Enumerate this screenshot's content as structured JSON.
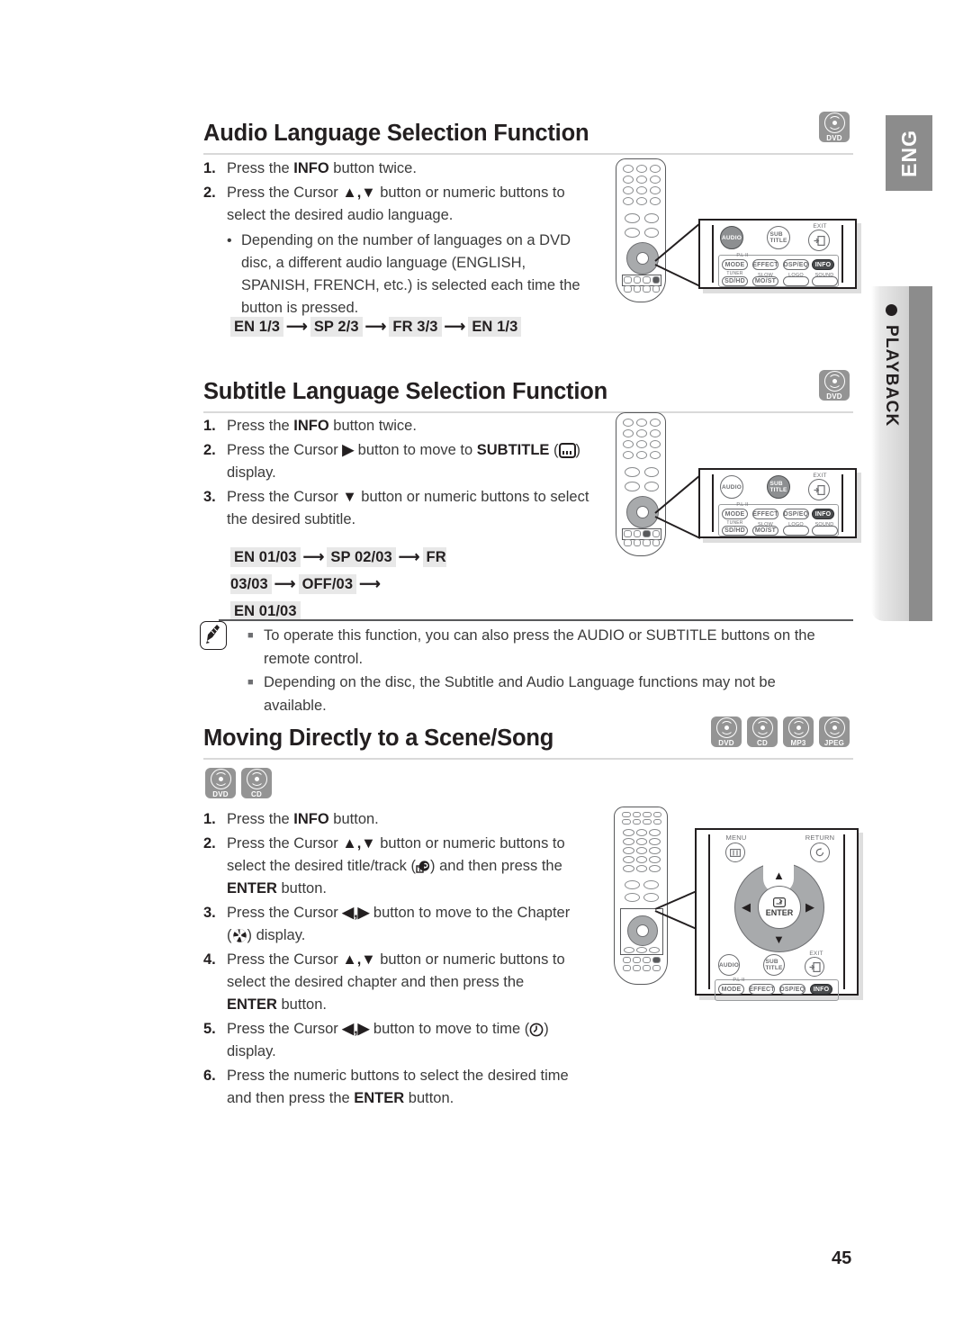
{
  "page": {
    "number": "45",
    "language_tab": "ENG",
    "section_tab": "PLAYBACK"
  },
  "sections": [
    {
      "id": "audio-language",
      "heading": "Audio Language Selection Function",
      "badges": [
        "DVD"
      ],
      "steps": [
        {
          "num": "1.",
          "parts": [
            {
              "t": "Press the "
            },
            {
              "t": "INFO",
              "b": true
            },
            {
              "t": " button twice."
            }
          ]
        },
        {
          "num": "2.",
          "parts": [
            {
              "t": "Press the Cursor "
            },
            {
              "t": "▲,▼",
              "b": true
            },
            {
              "t": " button or numeric buttons to select the desired audio language."
            }
          ]
        }
      ],
      "sub_bullet": "Depending on the number of languages on a DVD disc, a different audio language (ENGLISH, SPANISH, FRENCH, etc.) is selected each time the button is pressed.",
      "sequence": [
        "EN 1/3",
        "SP 2/3",
        "FR 3/3",
        "EN 1/3"
      ]
    },
    {
      "id": "subtitle-language",
      "heading": "Subtitle Language Selection Function",
      "badges": [
        "DVD"
      ],
      "steps": [
        {
          "num": "1.",
          "parts": [
            {
              "t": "Press the "
            },
            {
              "t": "INFO",
              "b": true
            },
            {
              "t": " button twice."
            }
          ]
        },
        {
          "num": "2.",
          "parts": [
            {
              "t": "Press the Cursor "
            },
            {
              "t": "▶",
              "b": true
            },
            {
              "t": " button to move to "
            },
            {
              "t": "SUBTITLE",
              "b": true
            },
            {
              "t": " (",
              "icon": "subtitle-icon"
            },
            {
              "t": ") display."
            }
          ]
        },
        {
          "num": "3.",
          "parts": [
            {
              "t": "Press the Cursor "
            },
            {
              "t": "▼",
              "b": true
            },
            {
              "t": " button or numeric buttons to select the desired subtitle."
            }
          ]
        }
      ],
      "sequence": [
        "EN 01/03",
        "SP 02/03",
        "FR 03/03",
        "OFF/03",
        "EN 01/03"
      ]
    },
    {
      "id": "moving-directly",
      "heading": "Moving Directly to a Scene/Song",
      "badges": [
        "DVD",
        "CD",
        "MP3",
        "JPEG"
      ],
      "inline_badges": [
        "DVD",
        "CD"
      ],
      "steps": [
        {
          "num": "1.",
          "parts": [
            {
              "t": "Press the "
            },
            {
              "t": "INFO",
              "b": true
            },
            {
              "t": " button."
            }
          ]
        },
        {
          "num": "2.",
          "parts": [
            {
              "t": "Press the Cursor "
            },
            {
              "t": "▲,▼",
              "b": true
            },
            {
              "t": " button or numeric buttons to select the desired title/track ("
            },
            {
              "icon": "title-track-icon"
            },
            {
              "t": ")  and then press the "
            },
            {
              "t": "ENTER",
              "b": true
            },
            {
              "t": " button."
            }
          ]
        },
        {
          "num": "3.",
          "parts": [
            {
              "t": "Press the Cursor "
            },
            {
              "t": "◀,▶",
              "b": true
            },
            {
              "t": " button to move to the Chapter ("
            },
            {
              "icon": "chapter-icon"
            },
            {
              "t": ") display."
            }
          ]
        },
        {
          "num": "4.",
          "parts": [
            {
              "t": "Press the Cursor "
            },
            {
              "t": "▲,▼",
              "b": true
            },
            {
              "t": " button or numeric buttons to select the desired chapter and then press the "
            },
            {
              "t": "ENTER",
              "b": true
            },
            {
              "t": " button."
            }
          ]
        },
        {
          "num": "5.",
          "parts": [
            {
              "t": "Press the Cursor "
            },
            {
              "t": "◀,▶",
              "b": true
            },
            {
              "t": " button to move to time ("
            },
            {
              "icon": "time-icon"
            },
            {
              "t": ") display."
            }
          ]
        },
        {
          "num": "6.",
          "parts": [
            {
              "t": "Press the numeric buttons to select the desired time and then press the "
            },
            {
              "t": "ENTER",
              "b": true
            },
            {
              "t": " button."
            }
          ]
        }
      ]
    }
  ],
  "note": {
    "icon": "note-pencil-icon",
    "items": [
      "To operate this function, you can also press the AUDIO or SUBTITLE buttons on the remote control.",
      "Depending on the disc, the Subtitle and Audio Language functions may not be available."
    ]
  },
  "callouts": {
    "audio": {
      "top_buttons": [
        {
          "label": "AUDIO",
          "highlighted": true
        },
        {
          "label": "SUB\nTITLE",
          "highlighted": false
        },
        {
          "label": "EXIT",
          "highlighted": false,
          "is_exit": true
        }
      ],
      "group_label": "P.L II",
      "row1": [
        {
          "label": "MODE",
          "highlighted": false
        },
        {
          "label": "EFFECT",
          "highlighted": false
        },
        {
          "label": "DSP/EQ",
          "highlighted": false
        },
        {
          "label": "INFO",
          "highlighted": true
        }
      ],
      "row2_labels": [
        "TUNER\nMEMORY",
        "SLOW",
        "LOGO",
        "SOUND EDIT"
      ],
      "row2": [
        {
          "label": "SD/HD"
        },
        {
          "label": "MO/ST"
        },
        {
          "label": ""
        },
        {
          "label": ""
        }
      ]
    },
    "subtitle": {
      "top_buttons": [
        {
          "label": "AUDIO",
          "highlighted": false
        },
        {
          "label": "SUB\nTITLE",
          "highlighted": true
        },
        {
          "label": "EXIT",
          "highlighted": false,
          "is_exit": true
        }
      ],
      "group_label": "P.L II",
      "row1": [
        {
          "label": "MODE",
          "highlighted": false
        },
        {
          "label": "EFFECT",
          "highlighted": false
        },
        {
          "label": "DSP/EQ",
          "highlighted": false
        },
        {
          "label": "INFO",
          "highlighted": true
        }
      ],
      "row2_labels": [
        "TUNER\nMEMORY",
        "SLOW",
        "LOGO",
        "SOUND EDIT"
      ],
      "row2": [
        {
          "label": "SD/HD"
        },
        {
          "label": "MO/ST"
        },
        {
          "label": ""
        },
        {
          "label": ""
        }
      ]
    },
    "navigation": {
      "menu_label": "MENU",
      "return_label": "RETURN",
      "enter_label": "ENTER",
      "arrows": {
        "up": "▲",
        "down": "▼",
        "left": "◀",
        "right": "▶"
      },
      "top_buttons": [
        {
          "label": "AUDIO",
          "highlighted": false
        },
        {
          "label": "SUB\nTITLE",
          "highlighted": false
        },
        {
          "label": "EXIT",
          "highlighted": false,
          "is_exit": true
        }
      ],
      "group_label": "P.L II",
      "row1": [
        {
          "label": "MODE",
          "highlighted": false
        },
        {
          "label": "EFFECT",
          "highlighted": false
        },
        {
          "label": "DSP/EQ",
          "highlighted": false
        },
        {
          "label": "INFO",
          "highlighted": true
        }
      ]
    }
  },
  "colors": {
    "tab_gray": "#8c8c8c",
    "badge_gray": "#949494",
    "chip_gray": "#e8e8e8",
    "rule_gray": "#d9d9d9",
    "text": "#231f20"
  }
}
